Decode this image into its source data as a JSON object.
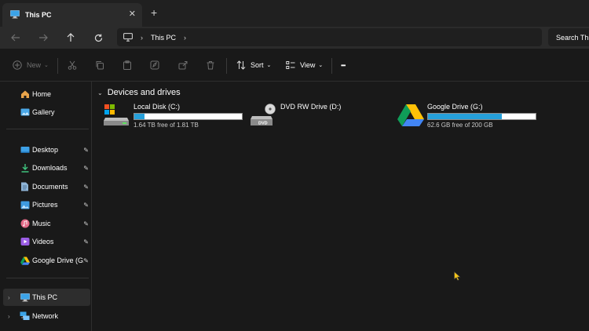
{
  "window": {
    "tab_title": "This PC",
    "close_glyph": "✕",
    "new_tab_glyph": "+"
  },
  "navigation": {
    "breadcrumb": [
      "This PC"
    ],
    "search_placeholder": "Search This PC"
  },
  "toolbar": {
    "new_label": "New",
    "sort_label": "Sort",
    "view_label": "View",
    "more_glyph": "•••"
  },
  "sidebar": {
    "top_items": [
      {
        "label": "Home",
        "icon": "home-icon"
      },
      {
        "label": "Gallery",
        "icon": "gallery-icon"
      }
    ],
    "quick_access": [
      {
        "label": "Desktop",
        "icon": "desktop-icon",
        "pinned": true
      },
      {
        "label": "Downloads",
        "icon": "downloads-icon",
        "pinned": true
      },
      {
        "label": "Documents",
        "icon": "documents-icon",
        "pinned": true
      },
      {
        "label": "Pictures",
        "icon": "pictures-icon",
        "pinned": true
      },
      {
        "label": "Music",
        "icon": "music-icon",
        "pinned": true
      },
      {
        "label": "Videos",
        "icon": "videos-icon",
        "pinned": true
      },
      {
        "label": "Google Drive (G:)",
        "icon": "google-drive-icon",
        "pinned": true
      }
    ],
    "locations": [
      {
        "label": "This PC",
        "icon": "this-pc-icon",
        "selected": true
      },
      {
        "label": "Network",
        "icon": "network-icon",
        "selected": false
      }
    ],
    "pin_glyph": "📌"
  },
  "main": {
    "group_title": "Devices and drives",
    "drives": [
      {
        "name": "Local Disk (C:)",
        "free_text": "1.64 TB free of 1.81 TB",
        "used_fraction": 0.094,
        "icon": "local-disk-icon"
      },
      {
        "name": "DVD RW Drive (D:)",
        "free_text": "",
        "used_fraction": null,
        "icon": "dvd-drive-icon",
        "icon_label": "DVD"
      },
      {
        "name": "Google Drive (G:)",
        "free_text": "62.6 GB free of 200 GB",
        "used_fraction": 0.687,
        "icon": "google-drive-icon"
      }
    ]
  },
  "colors": {
    "background": "#191919",
    "chrome": "#202020",
    "bar_fill": "#26a0da",
    "selection": "#2d2d2d"
  }
}
